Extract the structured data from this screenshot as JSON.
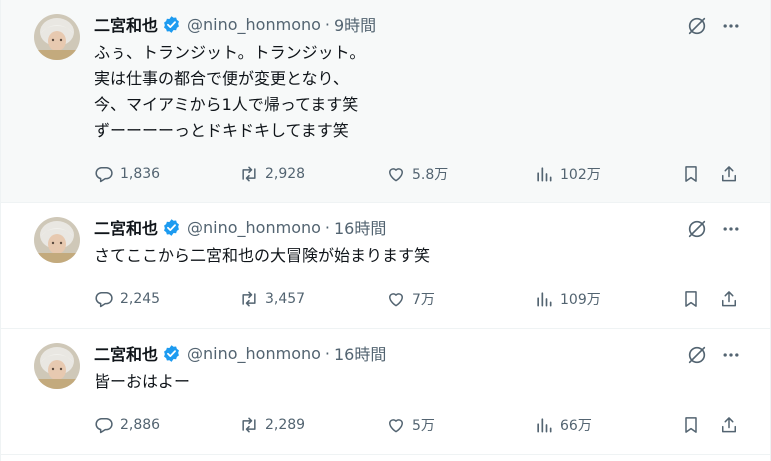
{
  "tweets": [
    {
      "author": "二宮和也",
      "handle": "@nino_honmono",
      "separator": "·",
      "time": "9時間",
      "lines": [
        "ふぅ、トランジット。トランジット。",
        "実は仕事の都合で便が変更となり、",
        "今、マイアミから1人で帰ってます笑",
        "ずーーーーっとドキドキしてます笑"
      ],
      "replies": "1,836",
      "retweets": "2,928",
      "likes": "5.8万",
      "views": "102万"
    },
    {
      "author": "二宮和也",
      "handle": "@nino_honmono",
      "separator": "·",
      "time": "16時間",
      "lines": [
        "さてここから二宮和也の大冒険が始まります笑"
      ],
      "replies": "2,245",
      "retweets": "3,457",
      "likes": "7万",
      "views": "109万"
    },
    {
      "author": "二宮和也",
      "handle": "@nino_honmono",
      "separator": "·",
      "time": "16時間",
      "lines": [
        "皆ーおはよー"
      ],
      "replies": "2,886",
      "retweets": "2,289",
      "likes": "5万",
      "views": "66万"
    }
  ],
  "icons": {
    "verified": "verified-badge-icon",
    "grok": "grok-icon",
    "more": "more-icon",
    "reply": "reply-icon",
    "retweet": "retweet-icon",
    "like": "heart-icon",
    "views": "views-icon",
    "bookmark": "bookmark-icon",
    "share": "share-icon"
  },
  "colors": {
    "text": "#0f1419",
    "secondary": "#536471",
    "verified": "#1d9bf0",
    "hover_background": "#f7f9f9",
    "border": "#eff3f4"
  }
}
